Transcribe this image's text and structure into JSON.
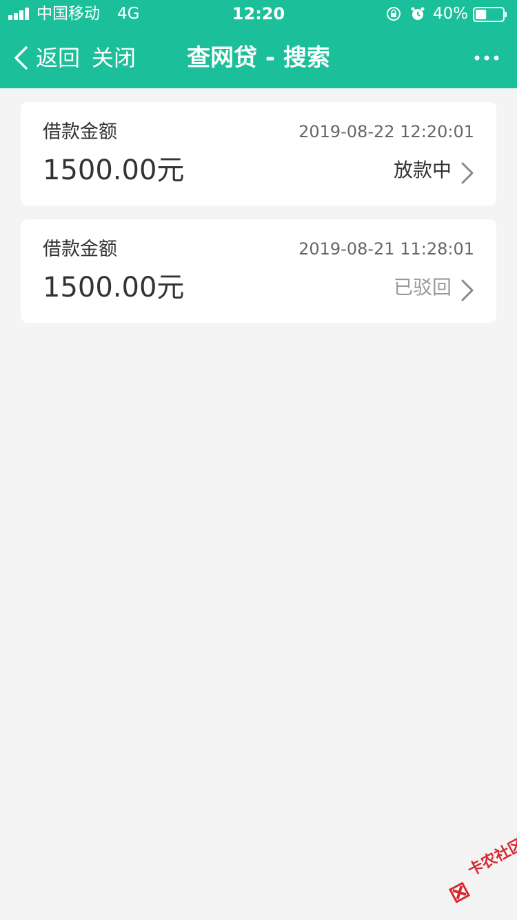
{
  "status_bar": {
    "carrier": "中国移动",
    "network": "4G",
    "time": "12:20",
    "battery_percent": "40%",
    "battery_level": 0.4,
    "signal_bars": 4
  },
  "nav": {
    "back_label": "返回",
    "close_label": "关闭",
    "title": "查网贷 - 搜索"
  },
  "colors": {
    "brand": "#1bbf9a",
    "background": "#f4f4f4",
    "status_active": "#333333",
    "status_rejected": "#999999"
  },
  "loans": [
    {
      "label": "借款金额",
      "time": "2019-08-22 12:20:01",
      "amount": "1500.00元",
      "status": "放款中"
    },
    {
      "label": "借款金额",
      "time": "2019-08-21 11:28:01",
      "amount": "1500.00元",
      "status": "已驳回"
    }
  ],
  "watermark": {
    "text": "卡农社区"
  }
}
